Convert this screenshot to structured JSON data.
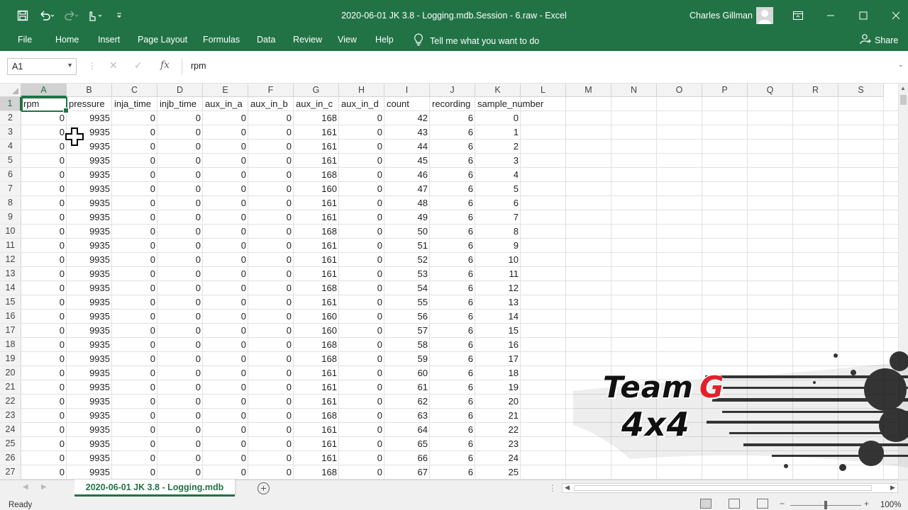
{
  "window": {
    "title": "2020-06-01 JK 3.8 - Logging.mdb.Session - 6.raw  -  Excel",
    "user": "Charles Gillman"
  },
  "ribbon": {
    "tabs": [
      "File",
      "Home",
      "Insert",
      "Page Layout",
      "Formulas",
      "Data",
      "Review",
      "View",
      "Help"
    ],
    "tell_me": "Tell me what you want to do",
    "share": "Share"
  },
  "formula_bar": {
    "name_box": "A1",
    "fx": "fx",
    "content": "rpm"
  },
  "sheet": {
    "columns": [
      "A",
      "B",
      "C",
      "D",
      "E",
      "F",
      "G",
      "H",
      "I",
      "J",
      "K",
      "L",
      "M",
      "N",
      "O",
      "P",
      "Q",
      "R",
      "S"
    ],
    "rows": [
      "1",
      "2",
      "3",
      "4",
      "5",
      "6",
      "7",
      "8",
      "9",
      "10",
      "11",
      "12",
      "13",
      "14",
      "15",
      "16",
      "17",
      "18",
      "19",
      "20",
      "21",
      "22",
      "23",
      "24",
      "25",
      "26",
      "27"
    ],
    "headers": [
      "rpm",
      "pressure",
      "inja_time",
      "injb_time",
      "aux_in_a",
      "aux_in_b",
      "aux_in_c",
      "aux_in_d",
      "count",
      "recording",
      "sample_number"
    ],
    "data": [
      [
        "0",
        "9935",
        "0",
        "0",
        "0",
        "0",
        "168",
        "0",
        "42",
        "6",
        "0"
      ],
      [
        "0",
        "9935",
        "0",
        "0",
        "0",
        "0",
        "161",
        "0",
        "43",
        "6",
        "1"
      ],
      [
        "0",
        "9935",
        "0",
        "0",
        "0",
        "0",
        "161",
        "0",
        "44",
        "6",
        "2"
      ],
      [
        "0",
        "9935",
        "0",
        "0",
        "0",
        "0",
        "161",
        "0",
        "45",
        "6",
        "3"
      ],
      [
        "0",
        "9935",
        "0",
        "0",
        "0",
        "0",
        "168",
        "0",
        "46",
        "6",
        "4"
      ],
      [
        "0",
        "9935",
        "0",
        "0",
        "0",
        "0",
        "160",
        "0",
        "47",
        "6",
        "5"
      ],
      [
        "0",
        "9935",
        "0",
        "0",
        "0",
        "0",
        "161",
        "0",
        "48",
        "6",
        "6"
      ],
      [
        "0",
        "9935",
        "0",
        "0",
        "0",
        "0",
        "161",
        "0",
        "49",
        "6",
        "7"
      ],
      [
        "0",
        "9935",
        "0",
        "0",
        "0",
        "0",
        "168",
        "0",
        "50",
        "6",
        "8"
      ],
      [
        "0",
        "9935",
        "0",
        "0",
        "0",
        "0",
        "161",
        "0",
        "51",
        "6",
        "9"
      ],
      [
        "0",
        "9935",
        "0",
        "0",
        "0",
        "0",
        "161",
        "0",
        "52",
        "6",
        "10"
      ],
      [
        "0",
        "9935",
        "0",
        "0",
        "0",
        "0",
        "161",
        "0",
        "53",
        "6",
        "11"
      ],
      [
        "0",
        "9935",
        "0",
        "0",
        "0",
        "0",
        "168",
        "0",
        "54",
        "6",
        "12"
      ],
      [
        "0",
        "9935",
        "0",
        "0",
        "0",
        "0",
        "161",
        "0",
        "55",
        "6",
        "13"
      ],
      [
        "0",
        "9935",
        "0",
        "0",
        "0",
        "0",
        "160",
        "0",
        "56",
        "6",
        "14"
      ],
      [
        "0",
        "9935",
        "0",
        "0",
        "0",
        "0",
        "160",
        "0",
        "57",
        "6",
        "15"
      ],
      [
        "0",
        "9935",
        "0",
        "0",
        "0",
        "0",
        "168",
        "0",
        "58",
        "6",
        "16"
      ],
      [
        "0",
        "9935",
        "0",
        "0",
        "0",
        "0",
        "168",
        "0",
        "59",
        "6",
        "17"
      ],
      [
        "0",
        "9935",
        "0",
        "0",
        "0",
        "0",
        "161",
        "0",
        "60",
        "6",
        "18"
      ],
      [
        "0",
        "9935",
        "0",
        "0",
        "0",
        "0",
        "161",
        "0",
        "61",
        "6",
        "19"
      ],
      [
        "0",
        "9935",
        "0",
        "0",
        "0",
        "0",
        "161",
        "0",
        "62",
        "6",
        "20"
      ],
      [
        "0",
        "9935",
        "0",
        "0",
        "0",
        "0",
        "168",
        "0",
        "63",
        "6",
        "21"
      ],
      [
        "0",
        "9935",
        "0",
        "0",
        "0",
        "0",
        "161",
        "0",
        "64",
        "6",
        "22"
      ],
      [
        "0",
        "9935",
        "0",
        "0",
        "0",
        "0",
        "161",
        "0",
        "65",
        "6",
        "23"
      ],
      [
        "0",
        "9935",
        "0",
        "0",
        "0",
        "0",
        "161",
        "0",
        "66",
        "6",
        "24"
      ],
      [
        "0",
        "9935",
        "0",
        "0",
        "0",
        "0",
        "168",
        "0",
        "67",
        "6",
        "25"
      ]
    ]
  },
  "sheet_tab": "2020-06-01 JK 3.8 - Logging.mdb",
  "status": {
    "text": "Ready",
    "zoom": "100%"
  },
  "logo": {
    "line1": "Team",
    "letter": "G",
    "line2": "4x4"
  },
  "colors": {
    "accent": "#217346",
    "logo_red": "#e3202a"
  },
  "icons": [
    "save-icon",
    "undo-icon",
    "redo-icon",
    "touch-mode-icon",
    "customize-qat-icon",
    "avatar-icon",
    "ribbon-display-icon",
    "minimize-icon",
    "maximize-icon",
    "close-icon",
    "lightbulb-icon",
    "share-icon",
    "fx-icon"
  ]
}
